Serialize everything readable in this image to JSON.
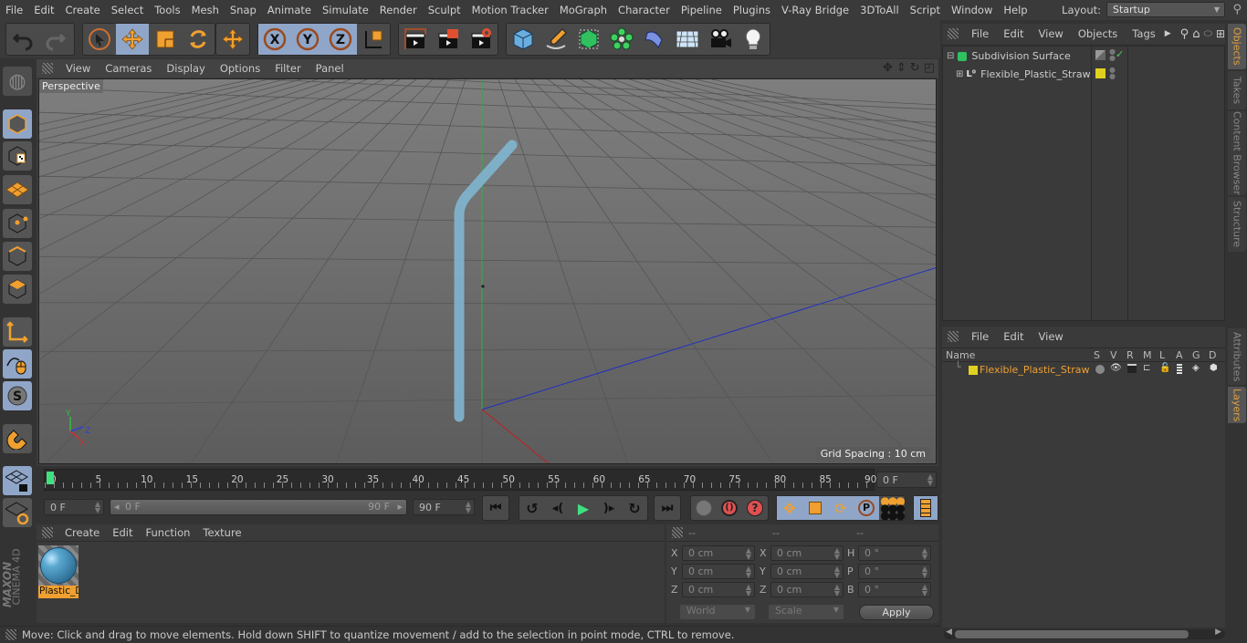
{
  "menubar": {
    "items": [
      "File",
      "Edit",
      "Create",
      "Select",
      "Tools",
      "Mesh",
      "Snap",
      "Animate",
      "Simulate",
      "Render",
      "Sculpt",
      "Motion Tracker",
      "MoGraph",
      "Character",
      "Pipeline",
      "Plugins",
      "V-Ray Bridge",
      "3DToAll",
      "Script",
      "Window",
      "Help"
    ],
    "layout_label": "Layout:",
    "layout_value": "Startup"
  },
  "toolbar": {
    "groups": [
      {
        "name": "history",
        "items": [
          "undo-icon",
          "redo-icon"
        ]
      },
      {
        "name": "tools",
        "items": [
          "live-selection-icon",
          "move-icon",
          "scale-icon",
          "rotate-icon"
        ]
      },
      {
        "name": "recent",
        "items": [
          "move-tool-icon"
        ]
      },
      {
        "name": "axes",
        "items": [
          "x-axis-icon",
          "y-axis-icon",
          "z-axis-icon",
          "world-coordinate-icon"
        ]
      },
      {
        "name": "render",
        "items": [
          "render-view-icon",
          "render-picture-viewer-icon",
          "render-settings-icon"
        ]
      },
      {
        "name": "objects",
        "items": [
          "cube-icon",
          "pen-icon",
          "subdivision-icon",
          "mograph-cloner-icon",
          "deformer-icon",
          "floor-icon",
          "camera-icon",
          "light-icon"
        ]
      }
    ]
  },
  "viewport": {
    "menu": [
      "View",
      "Cameras",
      "Display",
      "Options",
      "Filter",
      "Panel"
    ],
    "label": "Perspective",
    "grid_spacing": "Grid Spacing : 10 cm",
    "axis_labels": {
      "x": "X",
      "y": "Y",
      "z": "Z"
    }
  },
  "left_tools": [
    "make-editable-icon",
    "model-mode-icon",
    "texture-mode-icon",
    "workplane-icon",
    "points-mode-icon",
    "edges-mode-icon",
    "polygons-mode-icon",
    "axis-mode-icon",
    "tweak-mode-icon",
    "snap-icon",
    "magnet-icon",
    "lock-workplane-icon",
    "workplane-mode-icon"
  ],
  "timeline": {
    "ticks": [
      "0",
      "5",
      "10",
      "15",
      "20",
      "25",
      "30",
      "35",
      "40",
      "45",
      "50",
      "55",
      "60",
      "65",
      "70",
      "75",
      "80",
      "85",
      "90"
    ],
    "current_frame": "0 F",
    "start_field": "0 F",
    "range_start": "0 F",
    "range_end": "90 F",
    "end_field": "90 F",
    "playhead_frame": 0,
    "max_frame": 90
  },
  "transport": {
    "buttons": [
      "go-to-start-icon",
      "prev-key-icon",
      "prev-frame-icon",
      "play-icon",
      "next-frame-icon",
      "next-key-icon",
      "go-to-end-icon",
      "record-active-icon",
      "auto-key-icon",
      "keyframe-selection-icon",
      "key-position-icon",
      "key-scale-icon",
      "key-rotation-icon",
      "key-parameter-icon",
      "key-pla-icon",
      "timeline-icon"
    ]
  },
  "material_manager": {
    "menu": [
      "Create",
      "Edit",
      "Function",
      "Texture"
    ],
    "materials": [
      {
        "name": "Plastic_D"
      }
    ]
  },
  "coordinates": {
    "headers": [
      "--",
      "--",
      "--"
    ],
    "rows": [
      {
        "pos_label": "X",
        "pos": "0 cm",
        "size_label": "X",
        "size": "0 cm",
        "rot_label": "H",
        "rot": "0 °"
      },
      {
        "pos_label": "Y",
        "pos": "0 cm",
        "size_label": "Y",
        "size": "0 cm",
        "rot_label": "P",
        "rot": "0 °"
      },
      {
        "pos_label": "Z",
        "pos": "0 cm",
        "size_label": "Z",
        "size": "0 cm",
        "rot_label": "B",
        "rot": "0 °"
      }
    ],
    "mode": "World",
    "size_mode": "Scale",
    "apply": "Apply"
  },
  "object_manager": {
    "menu": [
      "File",
      "Edit",
      "View",
      "Objects",
      "Tags"
    ],
    "objects": [
      {
        "name": "Subdivision Surface",
        "icon": "subdivision-icon"
      },
      {
        "name": "Flexible_Plastic_Straw",
        "icon": "null-object-icon",
        "layer_color": "#e0d020"
      }
    ]
  },
  "layer_manager": {
    "menu": [
      "File",
      "Edit",
      "View"
    ],
    "columns": [
      "Name",
      "S",
      "V",
      "R",
      "M",
      "L",
      "A",
      "G",
      "D"
    ],
    "layers": [
      {
        "name": "Flexible_Plastic_Straw",
        "color": "#e0d020"
      }
    ]
  },
  "side_tabs_top": [
    "Objects",
    "Takes",
    "Content Browser",
    "Structure"
  ],
  "side_tabs_bottom": [
    "Attributes",
    "Layers"
  ],
  "brand": {
    "line1": "MAXON",
    "line2": "CINEMA 4D"
  },
  "status": "Move: Click and drag to move elements. Hold down SHIFT to quantize movement / add to the selection in point mode, CTRL to remove.",
  "colors": {
    "accent": "#f0a030",
    "selected_bg": "#8fa6c8",
    "layer": "#e0d020",
    "straw": "#7fb6d0"
  }
}
